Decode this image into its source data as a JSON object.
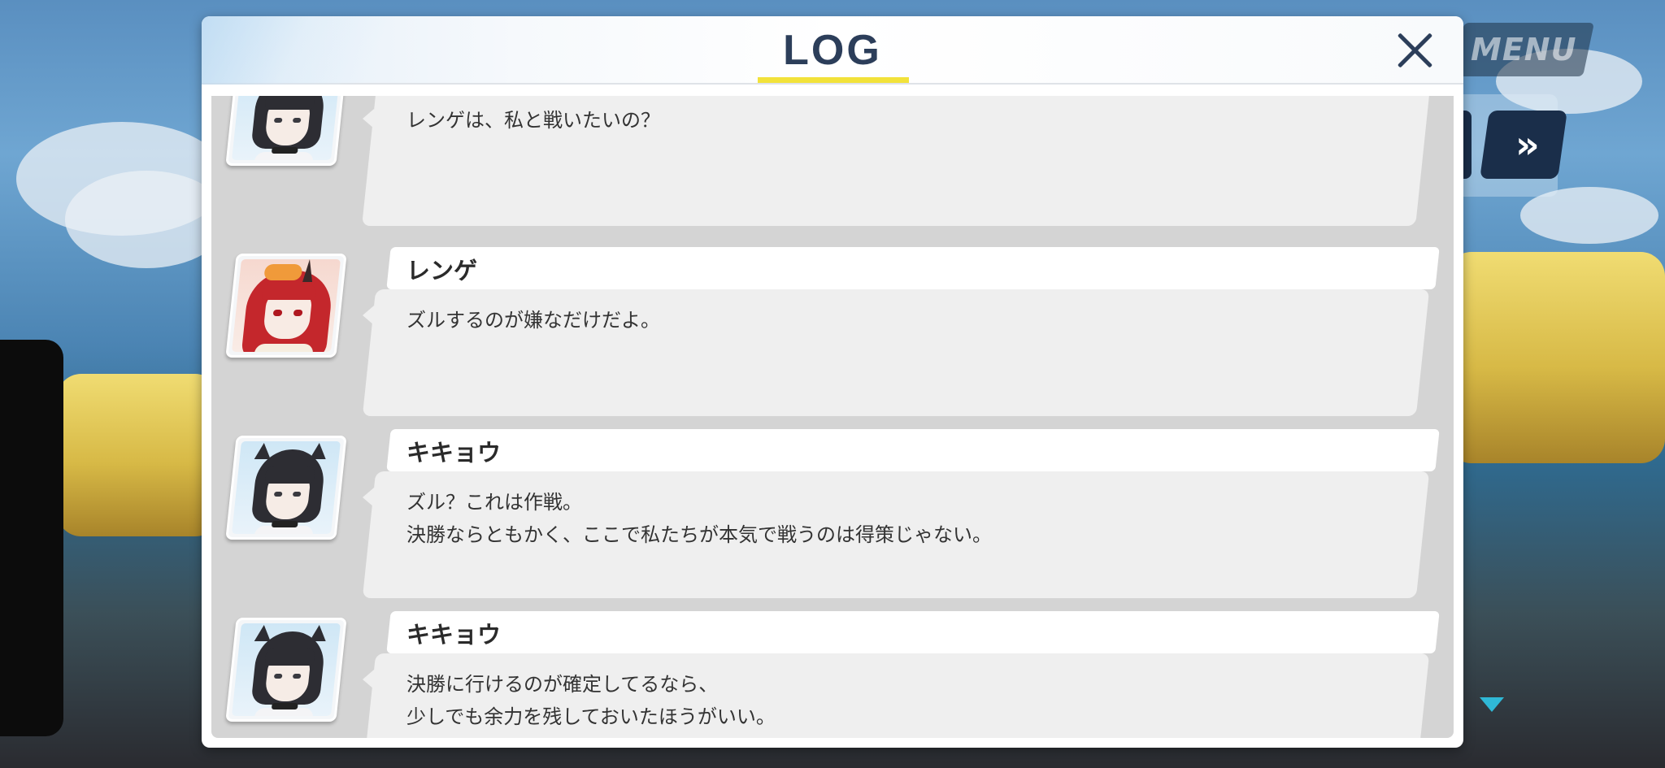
{
  "menu_label": "MENU",
  "log": {
    "title": "LOG",
    "entries": [
      {
        "speaker": "",
        "portrait": "kikyou",
        "lines": [
          "レンゲは、私と戦いたいの？"
        ]
      },
      {
        "speaker": "レンゲ",
        "portrait": "renge",
        "lines": [
          "ズルするのが嫌なだけだよ。"
        ]
      },
      {
        "speaker": "キキョウ",
        "portrait": "kikyou",
        "lines": [
          "ズル？これは作戦。",
          "決勝ならともかく、ここで私たちが本気で戦うのは得策じゃない。"
        ]
      },
      {
        "speaker": "キキョウ",
        "portrait": "kikyou",
        "lines": [
          "決勝に行けるのが確定してるなら、",
          "少しでも余力を残しておいたほうがいい。"
        ]
      }
    ]
  },
  "icons": {
    "close": "close-icon",
    "fast_forward": "fast-forward-icon",
    "scroll_down": "scroll-down-arrow-icon"
  },
  "colors": {
    "title_underline": "#f2e23a",
    "title_text": "#2c3e5a",
    "scroll_arrow": "#2fb8d6"
  }
}
